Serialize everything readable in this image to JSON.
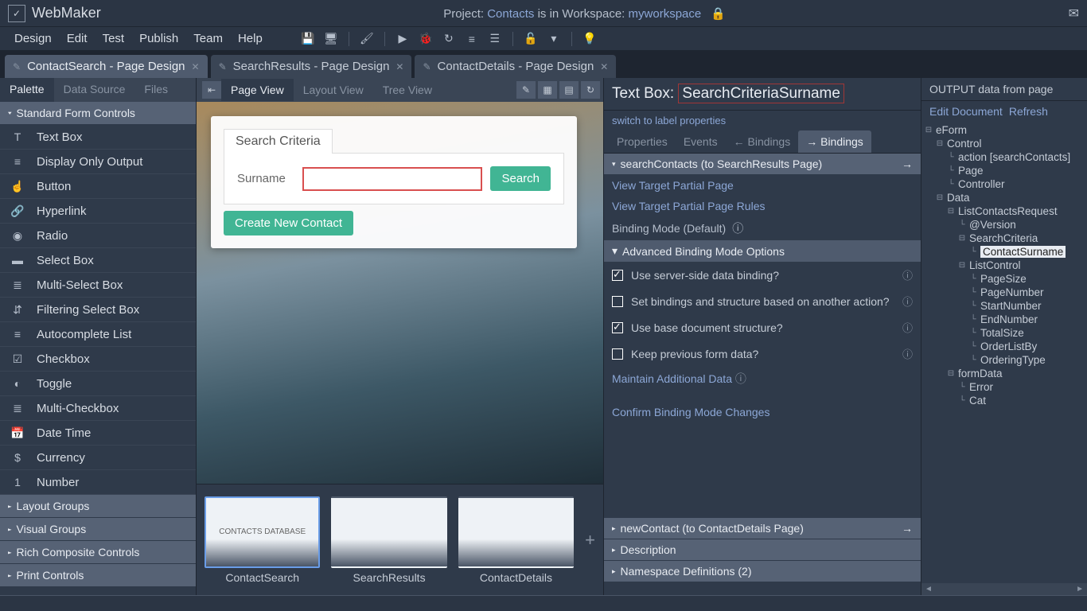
{
  "app": {
    "title": "WebMaker",
    "projectPrefix": "Project: ",
    "projectName": "Contacts",
    "wsLabel": " is in Workspace: ",
    "workspace": "myworkspace"
  },
  "menus": [
    "Design",
    "Edit",
    "Test",
    "Publish",
    "Team",
    "Help"
  ],
  "docTabs": [
    {
      "label": "ContactSearch - Page Design",
      "active": true
    },
    {
      "label": "SearchResults - Page Design",
      "active": false
    },
    {
      "label": "ContactDetails - Page Design",
      "active": false
    }
  ],
  "leftTabs": [
    "Palette",
    "Data Source",
    "Files"
  ],
  "palette": {
    "groups": [
      {
        "title": "Standard Form Controls",
        "open": true,
        "items": [
          {
            "icon": "T",
            "label": "Text Box"
          },
          {
            "icon": "≡",
            "label": "Display Only Output"
          },
          {
            "icon": "☝",
            "label": "Button"
          },
          {
            "icon": "🔗",
            "label": "Hyperlink"
          },
          {
            "icon": "◉",
            "label": "Radio"
          },
          {
            "icon": "▬",
            "label": "Select Box"
          },
          {
            "icon": "≣",
            "label": "Multi-Select Box"
          },
          {
            "icon": "⇵",
            "label": "Filtering Select Box"
          },
          {
            "icon": "≡",
            "label": "Autocomplete List"
          },
          {
            "icon": "☑",
            "label": "Checkbox"
          },
          {
            "icon": "◐",
            "label": "Toggle"
          },
          {
            "icon": "≣",
            "label": "Multi-Checkbox"
          },
          {
            "icon": "📅",
            "label": "Date Time"
          },
          {
            "icon": "$",
            "label": "Currency"
          },
          {
            "icon": "1",
            "label": "Number"
          }
        ]
      },
      {
        "title": "Layout Groups",
        "open": false
      },
      {
        "title": "Visual Groups",
        "open": false
      },
      {
        "title": "Rich Composite Controls",
        "open": false
      },
      {
        "title": "Print Controls",
        "open": false
      }
    ]
  },
  "centerTabs": [
    "Page View",
    "Layout View",
    "Tree View"
  ],
  "canvas": {
    "tabTitle": "Search Criteria",
    "fieldLabel": "Surname",
    "searchBtn": "Search",
    "createBtn": "Create New Contact"
  },
  "thumbs": [
    {
      "label": "ContactSearch",
      "caption": "CONTACTS DATABASE",
      "active": true
    },
    {
      "label": "SearchResults",
      "caption": "",
      "active": false
    },
    {
      "label": "ContactDetails",
      "caption": "",
      "active": false
    }
  ],
  "inspector": {
    "heading": "Text Box: ",
    "name": "SearchCriteriaSurname",
    "switch": "switch to label properties",
    "tabs": [
      "Properties",
      "Events",
      "← Bindings",
      "→ Bindings"
    ],
    "section1": "searchContacts (to SearchResults Page)",
    "links": [
      "View Target Partial Page",
      "View Target Partial Page Rules"
    ],
    "bindingMode": "Binding Mode (Default)",
    "advHdr": "Advanced Binding Mode Options",
    "opts": [
      {
        "label": "Use server-side data binding?",
        "checked": true
      },
      {
        "label": "Set bindings and structure based on another action?",
        "checked": false
      },
      {
        "label": "Use base document structure?",
        "checked": true
      },
      {
        "label": "Keep previous form data?",
        "checked": false
      }
    ],
    "maintain": "Maintain Additional Data",
    "confirm": "Confirm Binding Mode Changes",
    "bottomSections": [
      "newContact (to ContactDetails Page)",
      "Description",
      "Namespace Definitions (2)"
    ]
  },
  "output": {
    "title": "OUTPUT data from page",
    "actions": [
      "Edit Document",
      "Refresh"
    ],
    "tree": [
      {
        "d": 0,
        "t": "eForm",
        "e": "−"
      },
      {
        "d": 1,
        "t": "Control",
        "e": "−"
      },
      {
        "d": 2,
        "t": "action [searchContacts]",
        "e": ""
      },
      {
        "d": 2,
        "t": "Page",
        "e": ""
      },
      {
        "d": 2,
        "t": "Controller",
        "e": ""
      },
      {
        "d": 1,
        "t": "Data",
        "e": "−"
      },
      {
        "d": 2,
        "t": "ListContactsRequest",
        "e": "−"
      },
      {
        "d": 3,
        "t": "@Version",
        "e": ""
      },
      {
        "d": 3,
        "t": "SearchCriteria",
        "e": "−"
      },
      {
        "d": 4,
        "t": "ContactSurname",
        "e": "",
        "sel": true
      },
      {
        "d": 3,
        "t": "ListControl",
        "e": "−"
      },
      {
        "d": 4,
        "t": "PageSize",
        "e": ""
      },
      {
        "d": 4,
        "t": "PageNumber",
        "e": ""
      },
      {
        "d": 4,
        "t": "StartNumber",
        "e": ""
      },
      {
        "d": 4,
        "t": "EndNumber",
        "e": ""
      },
      {
        "d": 4,
        "t": "TotalSize",
        "e": ""
      },
      {
        "d": 4,
        "t": "OrderListBy",
        "e": ""
      },
      {
        "d": 4,
        "t": "OrderingType",
        "e": ""
      },
      {
        "d": 2,
        "t": "formData",
        "e": "−"
      },
      {
        "d": 3,
        "t": "Error",
        "e": ""
      },
      {
        "d": 3,
        "t": "Cat",
        "e": ""
      }
    ]
  }
}
